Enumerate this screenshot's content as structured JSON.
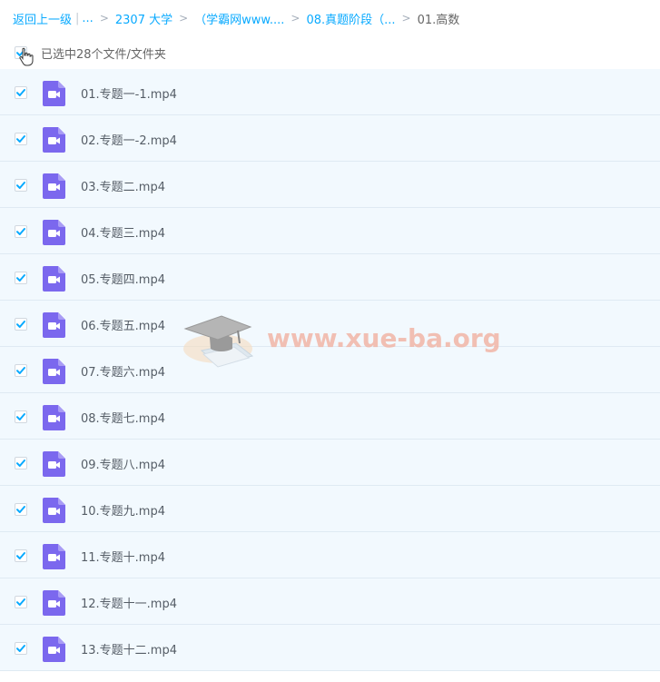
{
  "breadcrumb": {
    "back": "返回上一级",
    "ellipsis": "...",
    "items": [
      "2307 大学",
      "（学霸网www....",
      "08.真题阶段（...",
      "01.高数"
    ]
  },
  "selection": {
    "label": "已选中28个文件/文件夹"
  },
  "files": [
    {
      "name": "01.专题一-1.mp4",
      "checked": true
    },
    {
      "name": "02.专题一-2.mp4",
      "checked": true
    },
    {
      "name": "03.专题二.mp4",
      "checked": true
    },
    {
      "name": "04.专题三.mp4",
      "checked": true
    },
    {
      "name": "05.专题四.mp4",
      "checked": true
    },
    {
      "name": "06.专题五.mp4",
      "checked": true
    },
    {
      "name": "07.专题六.mp4",
      "checked": true
    },
    {
      "name": "08.专题七.mp4",
      "checked": true
    },
    {
      "name": "09.专题八.mp4",
      "checked": true
    },
    {
      "name": "10.专题九.mp4",
      "checked": true
    },
    {
      "name": "11.专题十.mp4",
      "checked": true
    },
    {
      "name": "12.专题十一.mp4",
      "checked": true
    },
    {
      "name": "13.专题十二.mp4",
      "checked": true
    }
  ],
  "watermark": {
    "text": "www.xue-ba.org"
  },
  "colors": {
    "accent": "#09aaff",
    "row_bg": "#f2f9fe",
    "video_icon": "#7b68ee"
  },
  "icons": {
    "file": "video-file-icon",
    "check": "checkmark-icon",
    "cursor": "hand-cursor-icon"
  }
}
